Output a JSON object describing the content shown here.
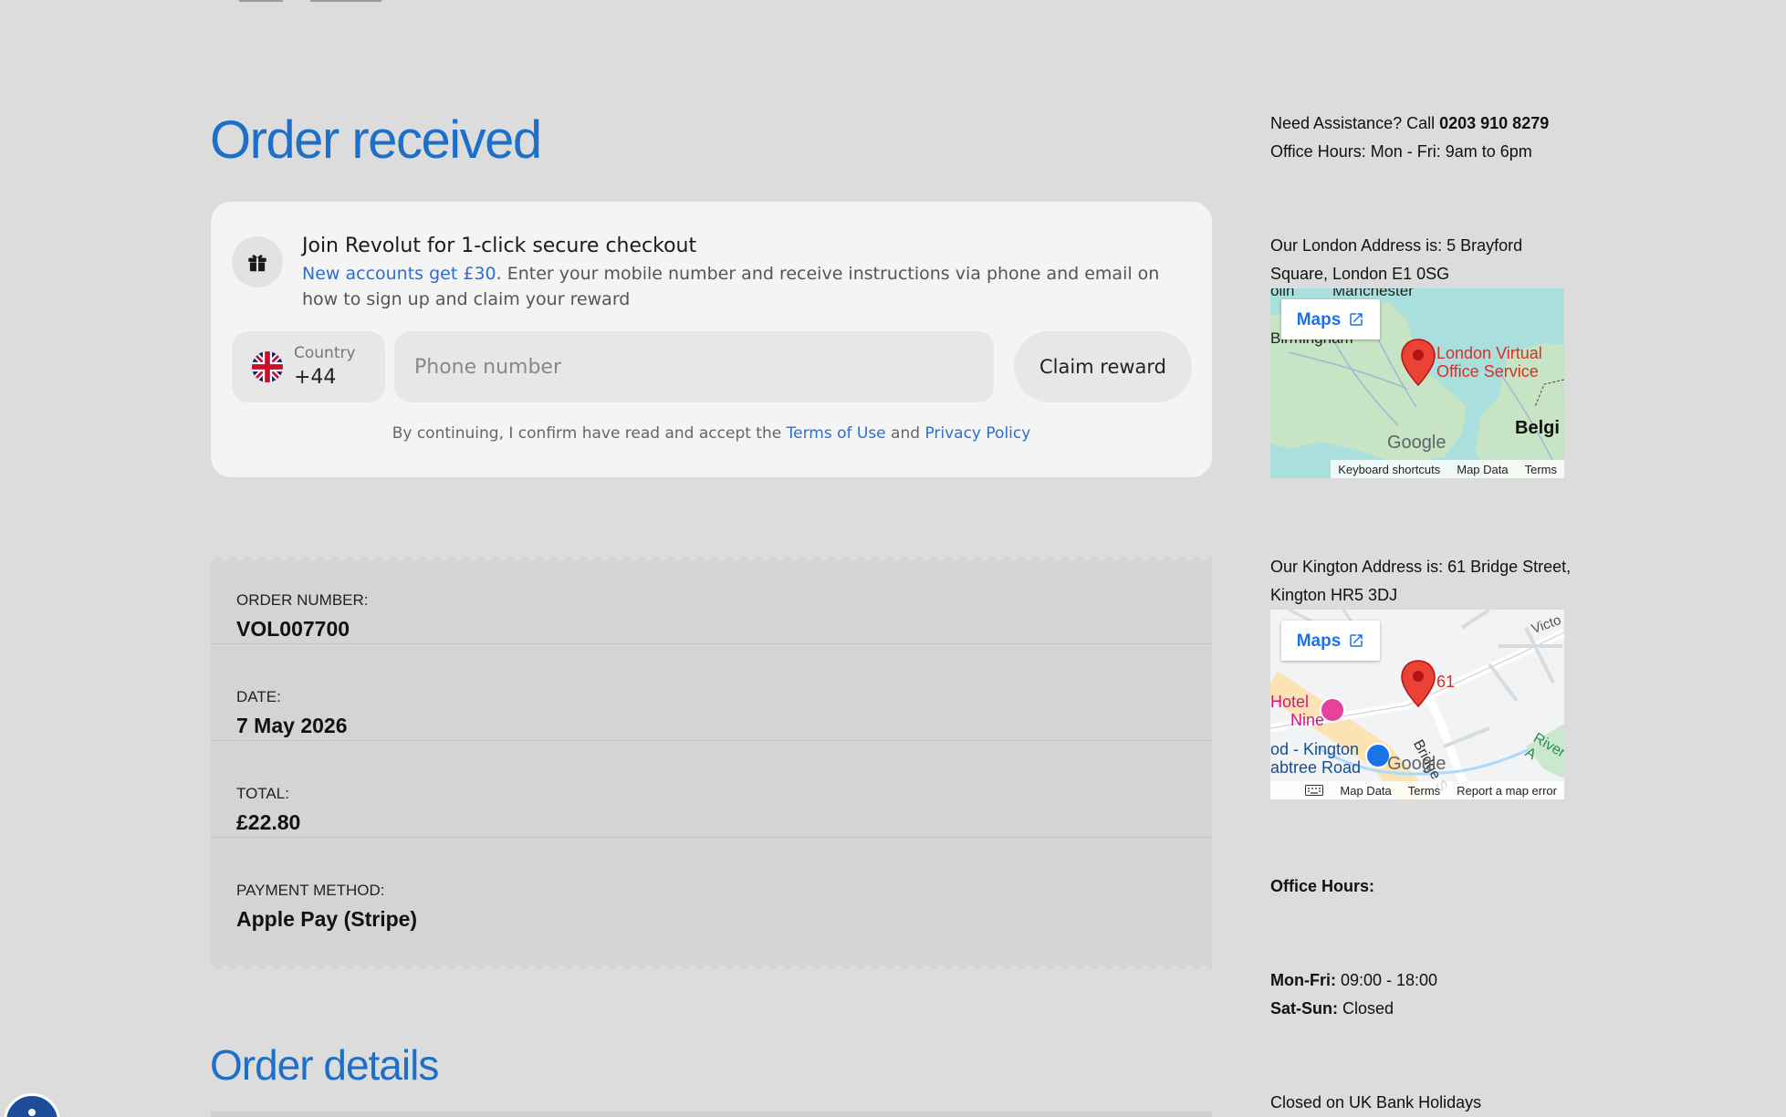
{
  "page": {
    "title": "Order received",
    "section_title": "Order details"
  },
  "revolut": {
    "title": "Join Revolut for 1-click secure checkout",
    "link_text": "New accounts get £30",
    "desc": ". Enter your mobile number and receive instructions via phone and email on how to sign up and claim your reward",
    "country_label": "Country",
    "country_code": "+44",
    "phone_placeholder": "Phone number",
    "claim_label": "Claim reward",
    "consent_prefix": "By continuing, I confirm have read and accept the",
    "terms_label": "Terms of Use",
    "and_label": "and",
    "privacy_label": "Privacy Policy",
    "accent": "#2d6fd1"
  },
  "order": {
    "rows": [
      {
        "label": "ORDER NUMBER:",
        "value": "VOL007700"
      },
      {
        "label": "DATE:",
        "value": "7 May 2026"
      },
      {
        "label": "TOTAL:",
        "value": "£22.80"
      },
      {
        "label": "PAYMENT METHOD:",
        "value": "Apple Pay (Stripe)"
      }
    ]
  },
  "sidebar": {
    "assist_prefix": "Need Assistance? Call ",
    "assist_phone": "0203 910 8279",
    "office_hours_line": "Office Hours: Mon - Fri: 9am to 6pm",
    "london_address": "Our London Address is: 5 Brayford Square, London E1 0SG",
    "kington_address": "Our Kington Address is: 61 Bridge Street, Kington HR5 3DJ",
    "hours_title": "Office Hours:",
    "monfri_label": "Mon-Fri:",
    "monfri_value": " 09:00 - 18:00",
    "satsun_label": "Sat-Sun:",
    "satsun_value": " Closed",
    "bank_holidays": "Closed on UK Bank Holidays"
  },
  "map_london": {
    "button_label": "Maps",
    "place_label_1": "London Virtual",
    "place_label_2": "Office Service",
    "city_top": "Manchester",
    "city_left_top": "olin",
    "city_left": "Birmingham",
    "country_right": "Belgi",
    "google": "Google",
    "footer": [
      "Keyboard shortcuts",
      "Map Data",
      "Terms"
    ]
  },
  "map_kington": {
    "button_label": "Maps",
    "place_label": "61",
    "hotel_1": "Hotel",
    "hotel_2": "Nine",
    "street_1": "od - Kington",
    "street_2": "abtree Road",
    "road": "Bridge S",
    "river": "River A",
    "road_top": "Victo",
    "google": "Google",
    "footer": [
      "Map Data",
      "Terms",
      "Report a map error"
    ]
  }
}
